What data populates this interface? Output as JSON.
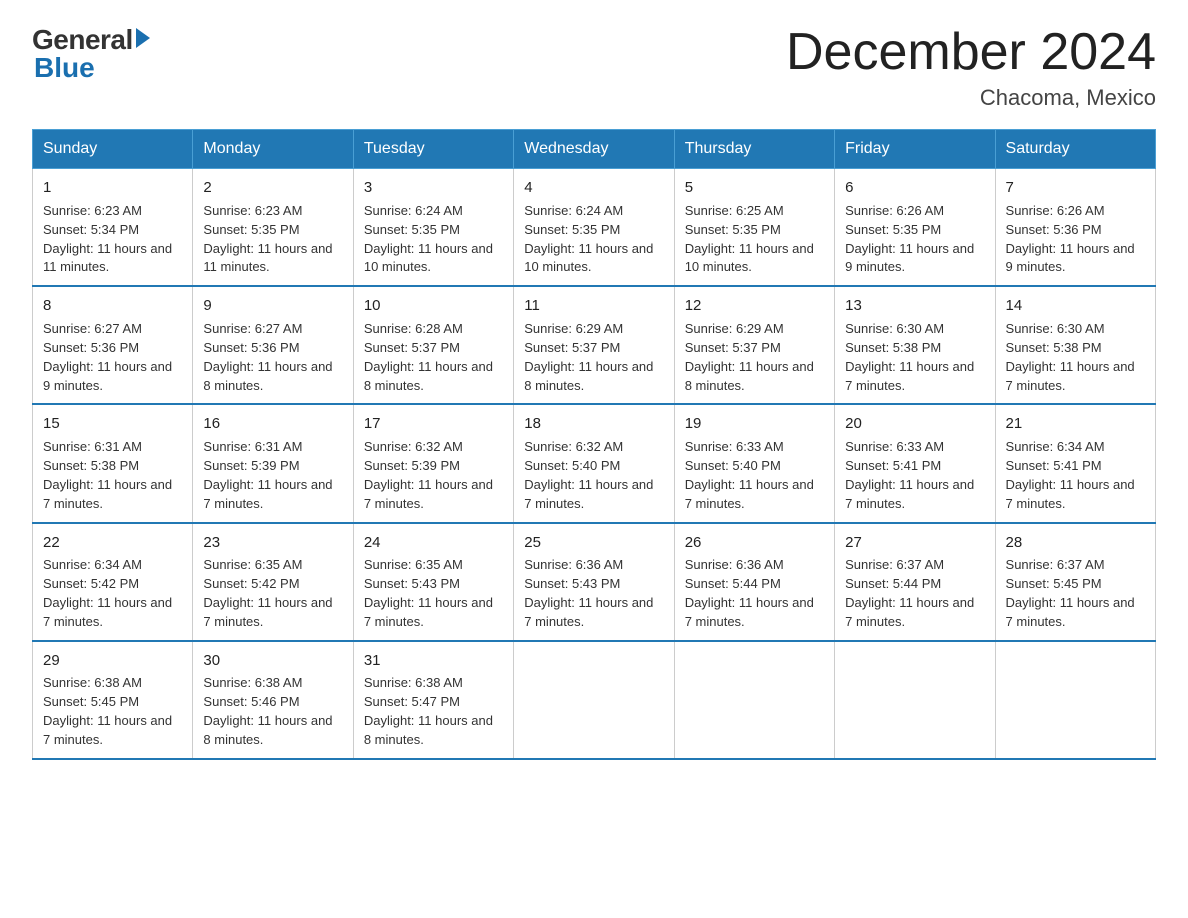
{
  "header": {
    "logo_general": "General",
    "logo_blue": "Blue",
    "month_title": "December 2024",
    "subtitle": "Chacoma, Mexico"
  },
  "calendar": {
    "headers": [
      "Sunday",
      "Monday",
      "Tuesday",
      "Wednesday",
      "Thursday",
      "Friday",
      "Saturday"
    ],
    "weeks": [
      [
        {
          "day": "1",
          "sunrise": "6:23 AM",
          "sunset": "5:34 PM",
          "daylight": "11 hours and 11 minutes."
        },
        {
          "day": "2",
          "sunrise": "6:23 AM",
          "sunset": "5:35 PM",
          "daylight": "11 hours and 11 minutes."
        },
        {
          "day": "3",
          "sunrise": "6:24 AM",
          "sunset": "5:35 PM",
          "daylight": "11 hours and 10 minutes."
        },
        {
          "day": "4",
          "sunrise": "6:24 AM",
          "sunset": "5:35 PM",
          "daylight": "11 hours and 10 minutes."
        },
        {
          "day": "5",
          "sunrise": "6:25 AM",
          "sunset": "5:35 PM",
          "daylight": "11 hours and 10 minutes."
        },
        {
          "day": "6",
          "sunrise": "6:26 AM",
          "sunset": "5:35 PM",
          "daylight": "11 hours and 9 minutes."
        },
        {
          "day": "7",
          "sunrise": "6:26 AM",
          "sunset": "5:36 PM",
          "daylight": "11 hours and 9 minutes."
        }
      ],
      [
        {
          "day": "8",
          "sunrise": "6:27 AM",
          "sunset": "5:36 PM",
          "daylight": "11 hours and 9 minutes."
        },
        {
          "day": "9",
          "sunrise": "6:27 AM",
          "sunset": "5:36 PM",
          "daylight": "11 hours and 8 minutes."
        },
        {
          "day": "10",
          "sunrise": "6:28 AM",
          "sunset": "5:37 PM",
          "daylight": "11 hours and 8 minutes."
        },
        {
          "day": "11",
          "sunrise": "6:29 AM",
          "sunset": "5:37 PM",
          "daylight": "11 hours and 8 minutes."
        },
        {
          "day": "12",
          "sunrise": "6:29 AM",
          "sunset": "5:37 PM",
          "daylight": "11 hours and 8 minutes."
        },
        {
          "day": "13",
          "sunrise": "6:30 AM",
          "sunset": "5:38 PM",
          "daylight": "11 hours and 7 minutes."
        },
        {
          "day": "14",
          "sunrise": "6:30 AM",
          "sunset": "5:38 PM",
          "daylight": "11 hours and 7 minutes."
        }
      ],
      [
        {
          "day": "15",
          "sunrise": "6:31 AM",
          "sunset": "5:38 PM",
          "daylight": "11 hours and 7 minutes."
        },
        {
          "day": "16",
          "sunrise": "6:31 AM",
          "sunset": "5:39 PM",
          "daylight": "11 hours and 7 minutes."
        },
        {
          "day": "17",
          "sunrise": "6:32 AM",
          "sunset": "5:39 PM",
          "daylight": "11 hours and 7 minutes."
        },
        {
          "day": "18",
          "sunrise": "6:32 AM",
          "sunset": "5:40 PM",
          "daylight": "11 hours and 7 minutes."
        },
        {
          "day": "19",
          "sunrise": "6:33 AM",
          "sunset": "5:40 PM",
          "daylight": "11 hours and 7 minutes."
        },
        {
          "day": "20",
          "sunrise": "6:33 AM",
          "sunset": "5:41 PM",
          "daylight": "11 hours and 7 minutes."
        },
        {
          "day": "21",
          "sunrise": "6:34 AM",
          "sunset": "5:41 PM",
          "daylight": "11 hours and 7 minutes."
        }
      ],
      [
        {
          "day": "22",
          "sunrise": "6:34 AM",
          "sunset": "5:42 PM",
          "daylight": "11 hours and 7 minutes."
        },
        {
          "day": "23",
          "sunrise": "6:35 AM",
          "sunset": "5:42 PM",
          "daylight": "11 hours and 7 minutes."
        },
        {
          "day": "24",
          "sunrise": "6:35 AM",
          "sunset": "5:43 PM",
          "daylight": "11 hours and 7 minutes."
        },
        {
          "day": "25",
          "sunrise": "6:36 AM",
          "sunset": "5:43 PM",
          "daylight": "11 hours and 7 minutes."
        },
        {
          "day": "26",
          "sunrise": "6:36 AM",
          "sunset": "5:44 PM",
          "daylight": "11 hours and 7 minutes."
        },
        {
          "day": "27",
          "sunrise": "6:37 AM",
          "sunset": "5:44 PM",
          "daylight": "11 hours and 7 minutes."
        },
        {
          "day": "28",
          "sunrise": "6:37 AM",
          "sunset": "5:45 PM",
          "daylight": "11 hours and 7 minutes."
        }
      ],
      [
        {
          "day": "29",
          "sunrise": "6:38 AM",
          "sunset": "5:45 PM",
          "daylight": "11 hours and 7 minutes."
        },
        {
          "day": "30",
          "sunrise": "6:38 AM",
          "sunset": "5:46 PM",
          "daylight": "11 hours and 8 minutes."
        },
        {
          "day": "31",
          "sunrise": "6:38 AM",
          "sunset": "5:47 PM",
          "daylight": "11 hours and 8 minutes."
        },
        null,
        null,
        null,
        null
      ]
    ]
  }
}
